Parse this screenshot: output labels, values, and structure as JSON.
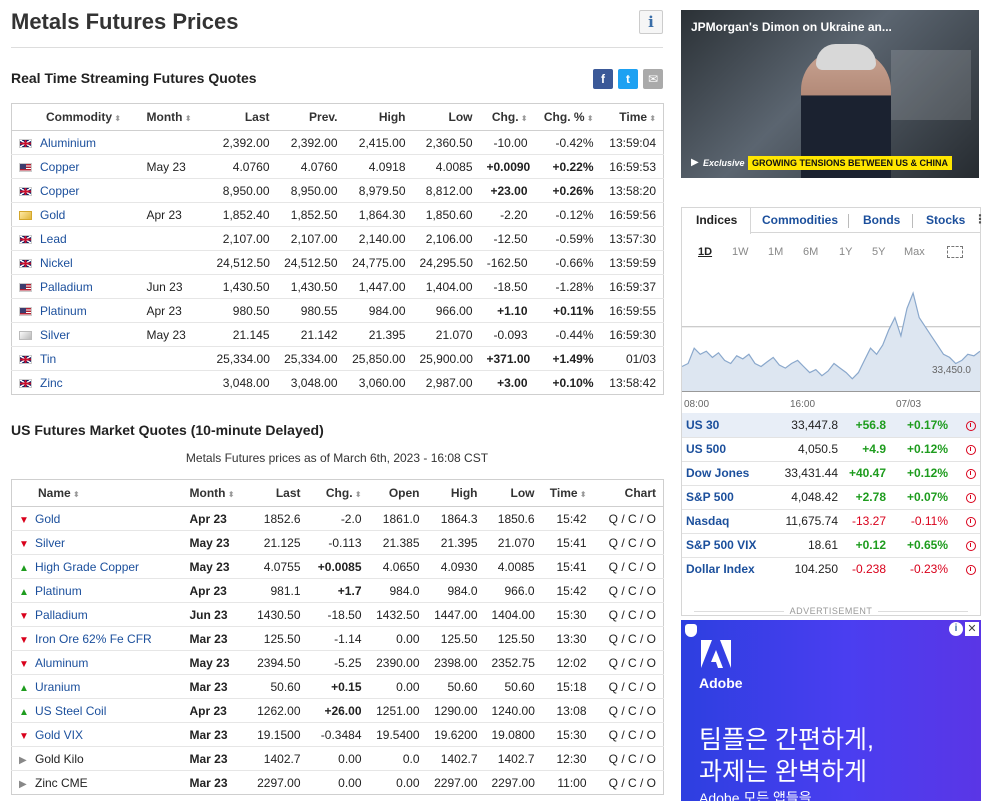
{
  "page": {
    "title": "Metals Futures Prices",
    "info_icon": "i"
  },
  "realtime": {
    "title": "Real Time Streaming Futures Quotes",
    "share": {
      "facebook": "f",
      "twitter": "t",
      "email": "✉"
    },
    "columns": [
      "Commodity",
      "Month",
      "Last",
      "Prev.",
      "High",
      "Low",
      "Chg.",
      "Chg. %",
      "Time"
    ],
    "rows": [
      {
        "flag": "uk",
        "name": "Aluminium",
        "month": "",
        "last": "2,392.00",
        "prev": "2,392.00",
        "high": "2,415.00",
        "low": "2,360.50",
        "chg": "-10.00",
        "pct": "-0.42%",
        "time": "13:59:04",
        "dir": "neg"
      },
      {
        "flag": "us",
        "name": "Copper",
        "month": "May 23",
        "last": "4.0760",
        "prev": "4.0760",
        "high": "4.0918",
        "low": "4.0085",
        "chg": "+0.0090",
        "pct": "+0.22%",
        "time": "16:59:53",
        "dir": "pos"
      },
      {
        "flag": "uk",
        "name": "Copper",
        "month": "",
        "last": "8,950.00",
        "prev": "8,950.00",
        "high": "8,979.50",
        "low": "8,812.00",
        "chg": "+23.00",
        "pct": "+0.26%",
        "time": "13:58:20",
        "dir": "pos"
      },
      {
        "flag": "gold",
        "name": "Gold",
        "month": "Apr 23",
        "last": "1,852.40",
        "prev": "1,852.50",
        "high": "1,864.30",
        "low": "1,850.60",
        "chg": "-2.20",
        "pct": "-0.12%",
        "time": "16:59:56",
        "dir": "neg"
      },
      {
        "flag": "uk",
        "name": "Lead",
        "month": "",
        "last": "2,107.00",
        "prev": "2,107.00",
        "high": "2,140.00",
        "low": "2,106.00",
        "chg": "-12.50",
        "pct": "-0.59%",
        "time": "13:57:30",
        "dir": "neg"
      },
      {
        "flag": "uk",
        "name": "Nickel",
        "month": "",
        "last": "24,512.50",
        "prev": "24,512.50",
        "high": "24,775.00",
        "low": "24,295.50",
        "chg": "-162.50",
        "pct": "-0.66%",
        "time": "13:59:59",
        "dir": "neg"
      },
      {
        "flag": "us",
        "name": "Palladium",
        "month": "Jun 23",
        "last": "1,430.50",
        "prev": "1,430.50",
        "high": "1,447.00",
        "low": "1,404.00",
        "chg": "-18.50",
        "pct": "-1.28%",
        "time": "16:59:37",
        "dir": "neg"
      },
      {
        "flag": "us",
        "name": "Platinum",
        "month": "Apr 23",
        "last": "980.50",
        "prev": "980.55",
        "high": "984.00",
        "low": "966.00",
        "chg": "+1.10",
        "pct": "+0.11%",
        "time": "16:59:55",
        "dir": "pos"
      },
      {
        "flag": "silver",
        "name": "Silver",
        "month": "May 23",
        "last": "21.145",
        "prev": "21.142",
        "high": "21.395",
        "low": "21.070",
        "chg": "-0.093",
        "pct": "-0.44%",
        "time": "16:59:30",
        "dir": "neg"
      },
      {
        "flag": "uk",
        "name": "Tin",
        "month": "",
        "last": "25,334.00",
        "prev": "25,334.00",
        "high": "25,850.00",
        "low": "25,900.00",
        "chg": "+371.00",
        "pct": "+1.49%",
        "time": "01/03",
        "dir": "pos"
      },
      {
        "flag": "uk",
        "name": "Zinc",
        "month": "",
        "last": "3,048.00",
        "prev": "3,048.00",
        "high": "3,060.00",
        "low": "2,987.00",
        "chg": "+3.00",
        "pct": "+0.10%",
        "time": "13:58:42",
        "dir": "pos"
      }
    ]
  },
  "us_futures": {
    "title": "US Futures Market Quotes (10-minute Delayed)",
    "subtitle": "Metals Futures prices as of March 6th, 2023 - 16:08 CST",
    "columns": [
      "Name",
      "Month",
      "Last",
      "Chg.",
      "Open",
      "High",
      "Low",
      "Time",
      "Chart"
    ],
    "rows": [
      {
        "arrow": "down",
        "name": "Gold",
        "month": "Apr 23",
        "last": "1852.6",
        "chg": "-2.0",
        "open": "1861.0",
        "high": "1864.3",
        "low": "1850.6",
        "time": "15:42",
        "chart": "Q / C / O",
        "dir": "neg"
      },
      {
        "arrow": "down",
        "name": "Silver",
        "month": "May 23",
        "last": "21.125",
        "chg": "-0.113",
        "open": "21.385",
        "high": "21.395",
        "low": "21.070",
        "time": "15:41",
        "chart": "Q / C / O",
        "dir": "neg"
      },
      {
        "arrow": "up",
        "name": "High Grade Copper",
        "month": "May 23",
        "last": "4.0755",
        "chg": "+0.0085",
        "open": "4.0650",
        "high": "4.0930",
        "low": "4.0085",
        "time": "15:41",
        "chart": "Q / C / O",
        "dir": "pos"
      },
      {
        "arrow": "up",
        "name": "Platinum",
        "month": "Apr 23",
        "last": "981.1",
        "chg": "+1.7",
        "open": "984.0",
        "high": "984.0",
        "low": "966.0",
        "time": "15:42",
        "chart": "Q / C / O",
        "dir": "pos"
      },
      {
        "arrow": "down",
        "name": "Palladium",
        "month": "Jun 23",
        "last": "1430.50",
        "chg": "-18.50",
        "open": "1432.50",
        "high": "1447.00",
        "low": "1404.00",
        "time": "15:30",
        "chart": "Q / C / O",
        "dir": "neg"
      },
      {
        "arrow": "down",
        "name": "Iron Ore 62% Fe CFR",
        "month": "Mar 23",
        "last": "125.50",
        "chg": "-1.14",
        "open": "0.00",
        "high": "125.50",
        "low": "125.50",
        "time": "13:30",
        "chart": "Q / C / O",
        "dir": "neg"
      },
      {
        "arrow": "down",
        "name": "Aluminum",
        "month": "May 23",
        "last": "2394.50",
        "chg": "-5.25",
        "open": "2390.00",
        "high": "2398.00",
        "low": "2352.75",
        "time": "12:02",
        "chart": "Q / C / O",
        "dir": "neg"
      },
      {
        "arrow": "up",
        "name": "Uranium",
        "month": "Mar 23",
        "last": "50.60",
        "chg": "+0.15",
        "open": "0.00",
        "high": "50.60",
        "low": "50.60",
        "time": "15:18",
        "chart": "Q / C / O",
        "dir": "pos"
      },
      {
        "arrow": "up",
        "name": "US Steel Coil",
        "month": "Apr 23",
        "last": "1262.00",
        "chg": "+26.00",
        "open": "1251.00",
        "high": "1290.00",
        "low": "1240.00",
        "time": "13:08",
        "chart": "Q / C / O",
        "dir": "pos"
      },
      {
        "arrow": "down",
        "name": "Gold VIX",
        "month": "Mar 23",
        "last": "19.1500",
        "chg": "-0.3484",
        "open": "19.5400",
        "high": "19.6200",
        "low": "19.0800",
        "time": "15:30",
        "chart": "Q / C / O",
        "dir": "neg"
      },
      {
        "arrow": "flat",
        "name": "Gold Kilo",
        "month": "Mar 23",
        "last": "1402.7",
        "chg": "0.00",
        "open": "0.0",
        "high": "1402.7",
        "low": "1402.7",
        "time": "12:30",
        "chart": "Q / C / O",
        "dir": "flat"
      },
      {
        "arrow": "flat",
        "name": "Zinc CME",
        "month": "Mar 23",
        "last": "2297.00",
        "chg": "0.00",
        "open": "0.00",
        "high": "2297.00",
        "low": "2297.00",
        "time": "11:00",
        "chart": "Q / C / O",
        "dir": "flat"
      }
    ]
  },
  "video": {
    "title": "JPMorgan's Dimon on Ukraine an...",
    "badge": "Exclusive",
    "lower_third": "GROWING TENSIONS BETWEEN US & CHINA"
  },
  "widget": {
    "tabs": [
      "Indices",
      "Commodities",
      "Bonds",
      "Stocks"
    ],
    "more": "⋮",
    "ranges": [
      "1D",
      "1W",
      "1M",
      "6M",
      "1Y",
      "5Y",
      "Max"
    ],
    "active_range": "1D",
    "chart": {
      "x_labels": [
        "08:00",
        "16:00",
        "07/03"
      ],
      "y_label": "33,450.0",
      "series": [
        33460,
        33470,
        33520,
        33500,
        33510,
        33490,
        33505,
        33480,
        33470,
        33495,
        33485,
        33500,
        33470,
        33460,
        33475,
        33490,
        33465,
        33455,
        33470,
        33480,
        33460,
        33440,
        33450,
        33430,
        33445,
        33470,
        33455,
        33440,
        33420,
        33440,
        33480,
        33520,
        33500,
        33530,
        33580,
        33620,
        33560,
        33650,
        33700,
        33620,
        33590,
        33560,
        33530,
        33500,
        33490,
        33470,
        33480,
        33500,
        33495,
        33510
      ],
      "y_min": 33380,
      "y_max": 33720,
      "baseline": 33590
    },
    "quotes": [
      {
        "name": "US 30",
        "last": "33,447.8",
        "chg": "+56.8",
        "pct": "+0.17%",
        "dir": "pos",
        "highlight": true
      },
      {
        "name": "US 500",
        "last": "4,050.5",
        "chg": "+4.9",
        "pct": "+0.12%",
        "dir": "pos",
        "highlight": false
      },
      {
        "name": "Dow Jones",
        "last": "33,431.44",
        "chg": "+40.47",
        "pct": "+0.12%",
        "dir": "pos",
        "highlight": false
      },
      {
        "name": "S&P 500",
        "last": "4,048.42",
        "chg": "+2.78",
        "pct": "+0.07%",
        "dir": "pos",
        "highlight": false
      },
      {
        "name": "Nasdaq",
        "last": "11,675.74",
        "chg": "-13.27",
        "pct": "-0.11%",
        "dir": "neg",
        "highlight": false
      },
      {
        "name": "S&P 500 VIX",
        "last": "18.61",
        "chg": "+0.12",
        "pct": "+0.65%",
        "dir": "pos",
        "highlight": false
      },
      {
        "name": "Dollar Index",
        "last": "104.250",
        "chg": "-0.238",
        "pct": "-0.23%",
        "dir": "neg",
        "highlight": false
      }
    ]
  },
  "ad": {
    "label": "ADVERTISEMENT",
    "brand": "Adobe",
    "line1": "팀플은 간편하게,",
    "line2": "과제는 완벽하게",
    "line3": "Adobe 모든 앱들을",
    "info": "i",
    "close": "✕"
  },
  "colors": {
    "positive": "#1e9c1e",
    "negative": "#d9001b",
    "link": "#1b4f9c",
    "ad_bg": "#3b3fe8"
  }
}
